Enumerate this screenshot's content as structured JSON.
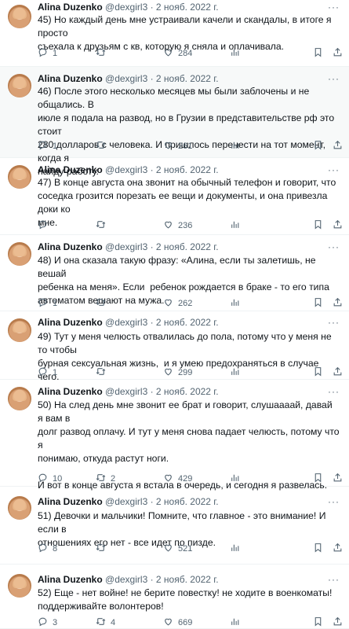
{
  "author": {
    "name": "Alina Duzenko",
    "handle": "@dexgirl3",
    "date": "· 2 нояб. 2022 г."
  },
  "more_glyph": "···",
  "tweets": [
    {
      "text": "45) Но каждый день мне устраивали качели и скандалы, в итоге я просто\nсъехала к друзьям с кв, которую я сняла и оплачивала.",
      "replies": "1",
      "retweets": "",
      "likes": "284"
    },
    {
      "text": "46) После этого несколько месяцев мы были заблочены и не общались. В\nиюле я подала на развод, но в Грузии в представительстве рф это стоит\n280 долларов с человека. И пришлось перенести на тот момент, когда я\nнайду работу.",
      "replies": "1",
      "retweets": "",
      "likes": "261"
    },
    {
      "text": "47) В конце августа она звонит на обычный телефон и говорит, что\nсоседка грозится порезать ее вещи и документы, и она привезла доки ко\nмне.",
      "replies": "",
      "retweets": "",
      "likes": "236"
    },
    {
      "text": "48) И она сказала такую фразу: «Алина, если ты залетишь, не вешай\nребенка на меня». Если  ребенок рождается в браке - то его типа\nавтоматом вешают на мужа.",
      "replies": "1",
      "retweets": "",
      "likes": "262"
    },
    {
      "text": "49) Тут у меня челюсть отвалилась до пола, потому что у меня не то чтобы\nбурная сексуальная жизнь,  и я умею предохраняться в случае чего.",
      "replies": "1",
      "retweets": "",
      "likes": "299"
    },
    {
      "text": "50) На след день мне звонит ее брат и говорит, слушаааай, давай я вам в\nдолг развод оплачу. И тут у меня снова падает челюсть, потому что я\nпонимаю, откуда растут ноги.\n\nИ вот в конце августа я встала в очередь, и сегодня я развелась.",
      "replies": "10",
      "retweets": "2",
      "likes": "429"
    },
    {
      "text": "51) Девочки и мальчики! Помните, что главное - это внимание! И если в\nотношениях его нет - все идет по пизде.",
      "replies": "8",
      "retweets": "",
      "likes": "521"
    },
    {
      "text": "52) Еще - нет войне! не берите повестку! не ходите в военкоматы!\nподдерживайте волонтеров!",
      "replies": "3",
      "retweets": "4",
      "likes": "669"
    }
  ]
}
